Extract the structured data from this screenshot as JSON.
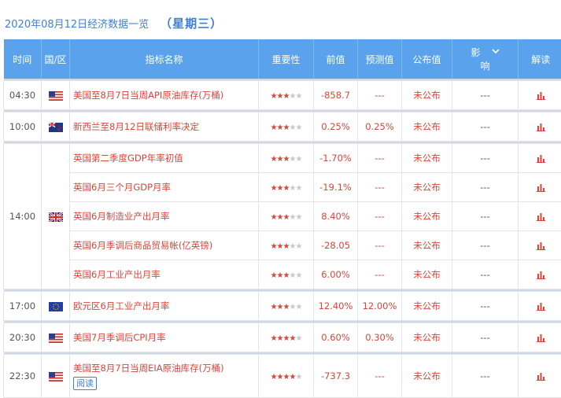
{
  "header": {
    "date_title": "2020年08月12日经济数据一览",
    "weekday": "（星期三）"
  },
  "columns": {
    "time": "时间",
    "country": "国/区",
    "indicator": "指标名称",
    "importance": "重要性",
    "previous": "前值",
    "forecast": "预测值",
    "actual": "公布值",
    "impact_top": "影",
    "impact_bottom": "响",
    "interpret": "解读"
  },
  "rows": [
    {
      "time": "04:30",
      "flag": "us-flag-icon",
      "indicator": "美国至8月7日当周API原油库存(万桶)",
      "stars": 3,
      "previous": "-858.7",
      "forecast": "---",
      "actual": "未公布",
      "impact": "---"
    },
    {
      "time": "10:00",
      "flag": "nz-flag-icon",
      "indicator": "新西兰至8月12日联储利率决定",
      "stars": 3,
      "previous": "0.25%",
      "forecast": "0.25%",
      "actual": "未公布",
      "impact": "---"
    },
    {
      "time": "14:00",
      "flag": "uk-flag-icon",
      "indicator": "英国第二季度GDP年率初值",
      "stars": 3,
      "previous": "-1.70%",
      "forecast": "---",
      "actual": "未公布",
      "impact": "---"
    },
    {
      "time": "",
      "flag": "",
      "indicator": "英国6月三个月GDP月率",
      "stars": 3,
      "previous": "-19.1%",
      "forecast": "---",
      "actual": "未公布",
      "impact": "---"
    },
    {
      "time": "",
      "flag": "",
      "indicator": "英国6月制造业产出月率",
      "stars": 3,
      "previous": "8.40%",
      "forecast": "---",
      "actual": "未公布",
      "impact": "---"
    },
    {
      "time": "",
      "flag": "",
      "indicator": "英国6月季调后商品贸易帐(亿英镑)",
      "stars": 3,
      "previous": "-28.05",
      "forecast": "---",
      "actual": "未公布",
      "impact": "---"
    },
    {
      "time": "",
      "flag": "",
      "indicator": "英国6月工业产出月率",
      "stars": 3,
      "previous": "6.00%",
      "forecast": "---",
      "actual": "未公布",
      "impact": "---"
    },
    {
      "time": "17:00",
      "flag": "eu-flag-icon",
      "indicator": "欧元区6月工业产出月率",
      "stars": 3,
      "previous": "12.40%",
      "forecast": "12.00%",
      "actual": "未公布",
      "impact": "---"
    },
    {
      "time": "20:30",
      "flag": "us-flag-icon",
      "indicator": "美国7月季调后CPI月率",
      "stars": 4,
      "previous": "0.60%",
      "forecast": "0.30%",
      "actual": "未公布",
      "impact": "---"
    },
    {
      "time": "22:30",
      "flag": "us-flag-icon",
      "indicator": "美国至8月7日当周EIA原油库存(万桶)",
      "stars": 4,
      "previous": "-737.3",
      "forecast": "---",
      "actual": "未公布",
      "impact": "---",
      "tag": "阅读"
    }
  ],
  "colors": {
    "header_bg": "#5aa3ec",
    "accent_red": "#d8453a",
    "title_blue": "#3e7fd6"
  }
}
